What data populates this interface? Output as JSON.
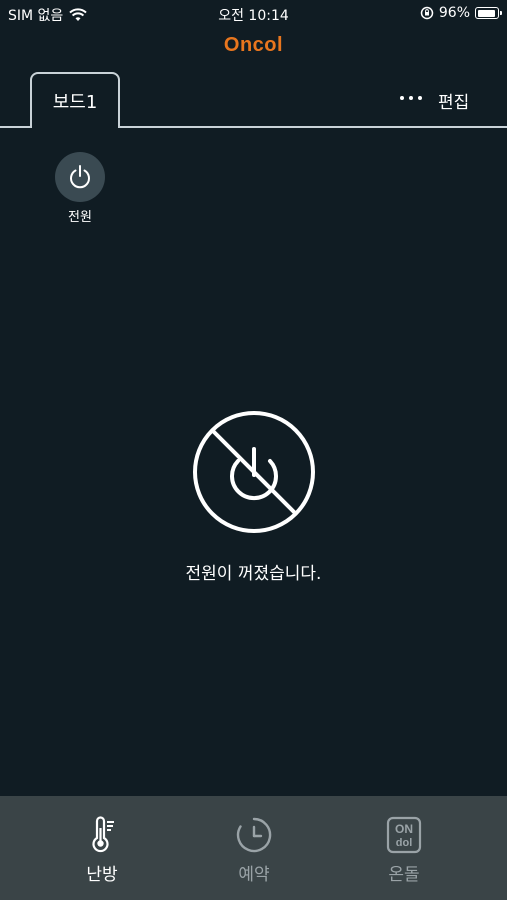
{
  "status_bar": {
    "carrier": "SIM 없음",
    "time": "오전 10:14",
    "battery_percent": "96%",
    "battery_level": 0.96,
    "icons": [
      "wifi-icon",
      "rotation-lock-icon",
      "battery-icon"
    ]
  },
  "header": {
    "logo_text": "Oncol",
    "logo_color": "#e8761e"
  },
  "tabs": {
    "board_label": "보드1",
    "edit_label": "편집",
    "more_icon": "more-dots-icon"
  },
  "power": {
    "label": "전원",
    "icon": "power-icon"
  },
  "status_message": {
    "icon": "power-off-prohibited-icon",
    "text": "전원이 꺼졌습니다."
  },
  "bottom_nav": {
    "items": [
      {
        "label": "난방",
        "icon": "thermometer-icon",
        "active": true
      },
      {
        "label": "예약",
        "icon": "clock-icon",
        "active": false
      },
      {
        "label": "온돌",
        "icon": "ondol-logo-icon",
        "active": false
      }
    ],
    "active_color": "#ffffff",
    "inactive_color": "#9aa3a7"
  },
  "colors": {
    "background": "#101c23",
    "nav_background": "#3a4447",
    "accent": "#e8761e"
  }
}
